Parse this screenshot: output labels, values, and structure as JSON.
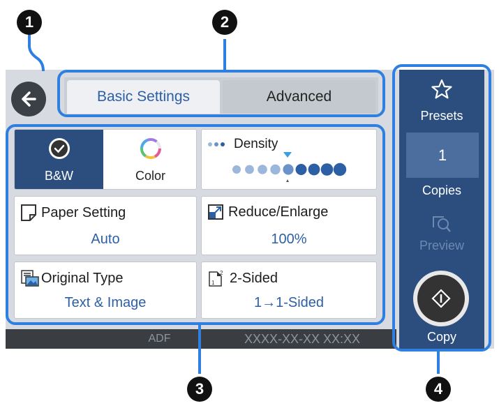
{
  "callouts": [
    "1",
    "2",
    "3",
    "4"
  ],
  "tabs": {
    "basic": "Basic Settings",
    "advanced": "Advanced"
  },
  "color_mode": {
    "bw_label": "B&W",
    "color_label": "Color"
  },
  "density": {
    "label": "Density",
    "level": 5,
    "max": 9
  },
  "paper_setting": {
    "label": "Paper Setting",
    "value": "Auto"
  },
  "reduce_enlarge": {
    "label": "Reduce/Enlarge",
    "value": "100%"
  },
  "original_type": {
    "label": "Original Type",
    "value": "Text & Image"
  },
  "two_sided": {
    "label": "2-Sided",
    "value": "1→1-Sided"
  },
  "sidebar": {
    "presets": "Presets",
    "copies_value": "1",
    "copies_label": "Copies",
    "preview": "Preview",
    "copy": "Copy"
  },
  "status": {
    "adf": "ADF",
    "datetime": "XXXX-XX-XX XX:XX"
  },
  "colors": {
    "highlight": "#2f7fe0",
    "panel": "#2b4e7f",
    "accent_text": "#2d5fa5"
  }
}
